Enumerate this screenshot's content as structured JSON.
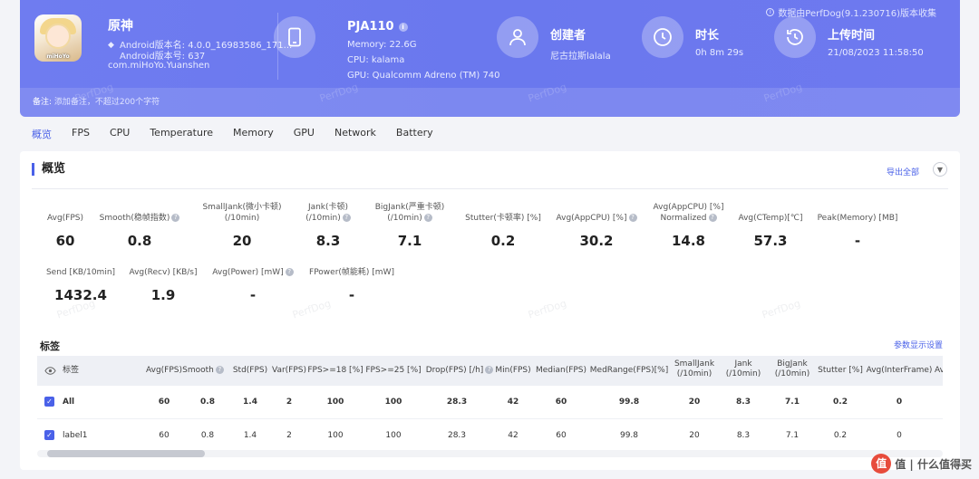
{
  "header": {
    "data_source": "数据由PerfDog(9.1.230716)版本收集",
    "app": {
      "name": "原神",
      "version": "Android版本名: 4.0.0_16983586_171...",
      "code": "Android版本号: 637",
      "package": "com.miHoYo.Yuanshen",
      "logo_text": "miHoYo"
    },
    "device": {
      "model": "PJA110",
      "memory": "Memory: 22.6G",
      "cpu": "CPU: kalama",
      "gpu": "GPU: Qualcomm Adreno (TM) 740"
    },
    "creator": {
      "label": "创建者",
      "value": "尼古拉斯lalala"
    },
    "duration": {
      "label": "时长",
      "value": "0h 8m 29s"
    },
    "upload": {
      "label": "上传时间",
      "value": "21/08/2023 11:58:50"
    },
    "note_label": "备注:",
    "note_placeholder": "添加备注，不超过200个字符",
    "watermark": "PerfDog"
  },
  "tabs": [
    "概览",
    "FPS",
    "CPU",
    "Temperature",
    "Memory",
    "GPU",
    "Network",
    "Battery"
  ],
  "overview": {
    "title": "概览",
    "export": "导出全部",
    "metrics": [
      {
        "label1": "Avg(FPS)",
        "label2": "",
        "value": "60"
      },
      {
        "label1": "Smooth(稳帧指数)",
        "label2": "",
        "value": "0.8"
      },
      {
        "label1": "SmallJank(微小卡顿)",
        "label2": "(/10min)",
        "value": "20"
      },
      {
        "label1": "Jank(卡顿)",
        "label2": "(/10min)",
        "value": "8.3"
      },
      {
        "label1": "BigJank(严重卡顿)",
        "label2": "(/10min)",
        "value": "7.1"
      },
      {
        "label1": "Stutter(卡顿率) [%]",
        "label2": "",
        "value": "0.2"
      },
      {
        "label1": "Avg(AppCPU) [%]",
        "label2": "",
        "value": "30.2"
      },
      {
        "label1": "Avg(AppCPU) [%]",
        "label2": "Normalized",
        "value": "14.8"
      },
      {
        "label1": "Avg(CTemp)[℃]",
        "label2": "",
        "value": "57.3"
      },
      {
        "label1": "Peak(Memory) [MB]",
        "label2": "",
        "value": "-"
      },
      {
        "label1": "Send [KB/10min]",
        "label2": "",
        "value": "1432.4"
      },
      {
        "label1": "Avg(Recv) [KB/s]",
        "label2": "",
        "value": "1.9"
      },
      {
        "label1": "Avg(Power) [mW]",
        "label2": "",
        "value": "-"
      },
      {
        "label1": "FPower(帧能耗) [mW]",
        "label2": "",
        "value": "-"
      }
    ]
  },
  "tags": {
    "title": "标签",
    "settings": "参数显示设置",
    "columns": [
      {
        "l1": "标签",
        "l2": ""
      },
      {
        "l1": "Avg(FPS)",
        "l2": ""
      },
      {
        "l1": "Smooth",
        "l2": ""
      },
      {
        "l1": "Std(FPS)",
        "l2": ""
      },
      {
        "l1": "Var(FPS)",
        "l2": ""
      },
      {
        "l1": "FPS>=18 [%]",
        "l2": ""
      },
      {
        "l1": "FPS>=25 [%]",
        "l2": ""
      },
      {
        "l1": "Drop(FPS) [/h]",
        "l2": ""
      },
      {
        "l1": "Min(FPS)",
        "l2": ""
      },
      {
        "l1": "Median(FPS)",
        "l2": ""
      },
      {
        "l1": "MedRange(FPS)[%]",
        "l2": ""
      },
      {
        "l1": "SmallJank",
        "l2": "(/10min)"
      },
      {
        "l1": "Jank",
        "l2": "(/10min)"
      },
      {
        "l1": "BigJank",
        "l2": "(/10min)"
      },
      {
        "l1": "Stutter [%]",
        "l2": ""
      },
      {
        "l1": "Avg(InterFrame)",
        "l2": ""
      },
      {
        "l1": "Avg(F",
        "l2": ""
      }
    ],
    "rows": [
      {
        "cells": [
          "All",
          "60",
          "0.8",
          "1.4",
          "2",
          "100",
          "100",
          "28.3",
          "42",
          "60",
          "99.8",
          "20",
          "8.3",
          "7.1",
          "0.2",
          "0"
        ]
      },
      {
        "cells": [
          "label1",
          "60",
          "0.8",
          "1.4",
          "2",
          "100",
          "100",
          "28.3",
          "42",
          "60",
          "99.8",
          "20",
          "8.3",
          "7.1",
          "0.2",
          "0"
        ]
      }
    ]
  },
  "footer": {
    "brand": "值 | 什么值得买",
    "logo_text": "值"
  }
}
